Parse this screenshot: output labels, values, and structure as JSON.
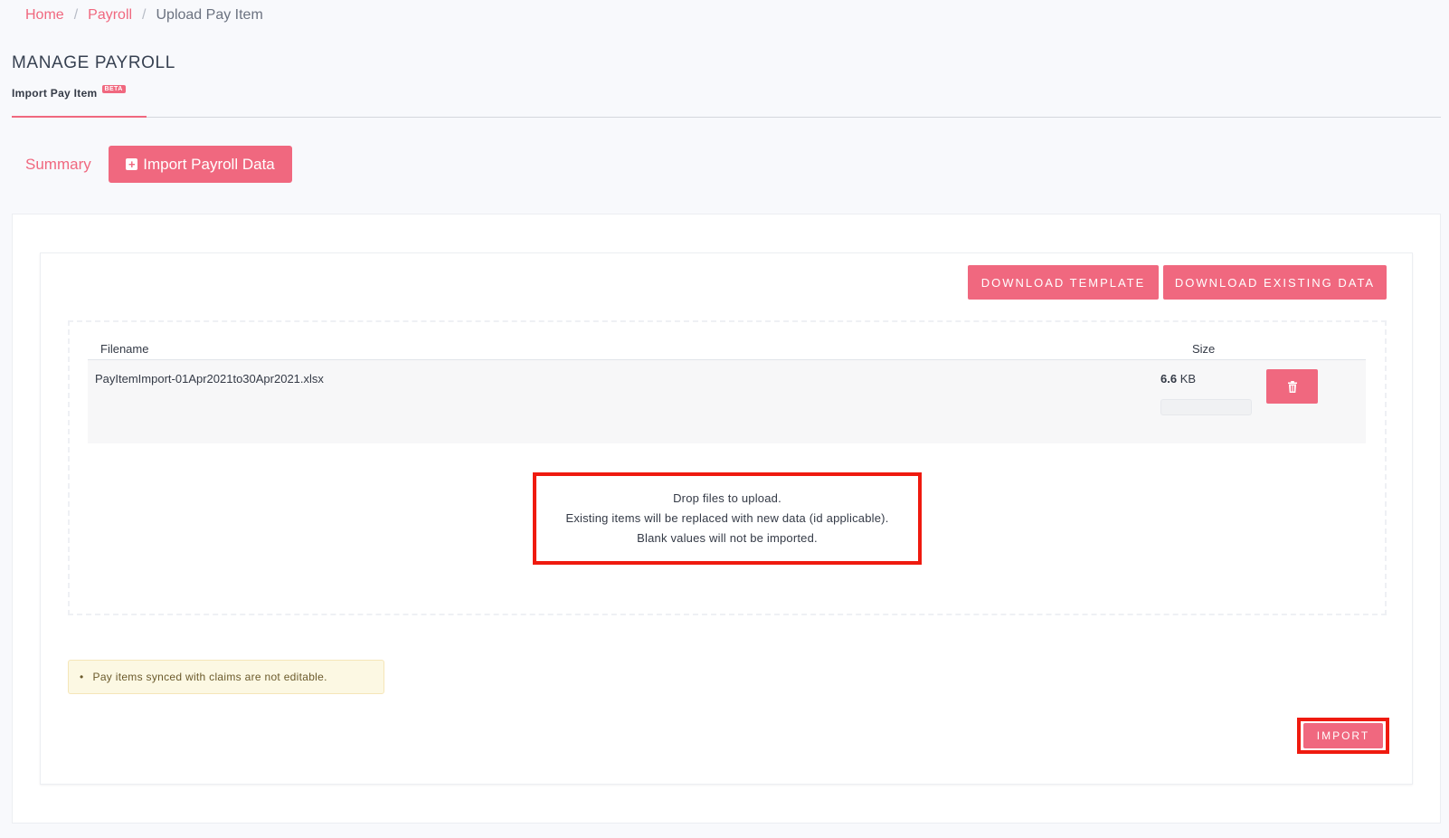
{
  "breadcrumb": {
    "home": "Home",
    "payroll": "Payroll",
    "current": "Upload Pay Item",
    "separator": "/"
  },
  "header": {
    "title": "MANAGE PAYROLL",
    "subtab": "Import Pay Item",
    "beta_badge": "BETA"
  },
  "actions": {
    "summary": "Summary",
    "import_payroll_data": "Import Payroll Data"
  },
  "toolbar": {
    "download_template": "DOWNLOAD TEMPLATE",
    "download_existing": "DOWNLOAD EXISTING DATA"
  },
  "file_table": {
    "headers": {
      "filename": "Filename",
      "size": "Size"
    },
    "rows": [
      {
        "filename": "PayItemImport-01Apr2021to30Apr2021.xlsx",
        "size_value": "6.6",
        "size_unit": "KB",
        "upload_progress": 0
      }
    ]
  },
  "dropzone": {
    "line1": "Drop files to upload.",
    "line2": "Existing items will be replaced with new data (id applicable).",
    "line3": "Blank values will not be imported."
  },
  "note": {
    "bullet": "•",
    "text": "Pay items synced with claims are not editable."
  },
  "footer": {
    "import": "IMPORT"
  },
  "icons": {
    "add": "plus-square-icon",
    "delete": "trash-icon"
  },
  "colors": {
    "accent": "#f0687f",
    "highlight": "#ef1a0f",
    "note_bg": "#fcf8e3"
  }
}
